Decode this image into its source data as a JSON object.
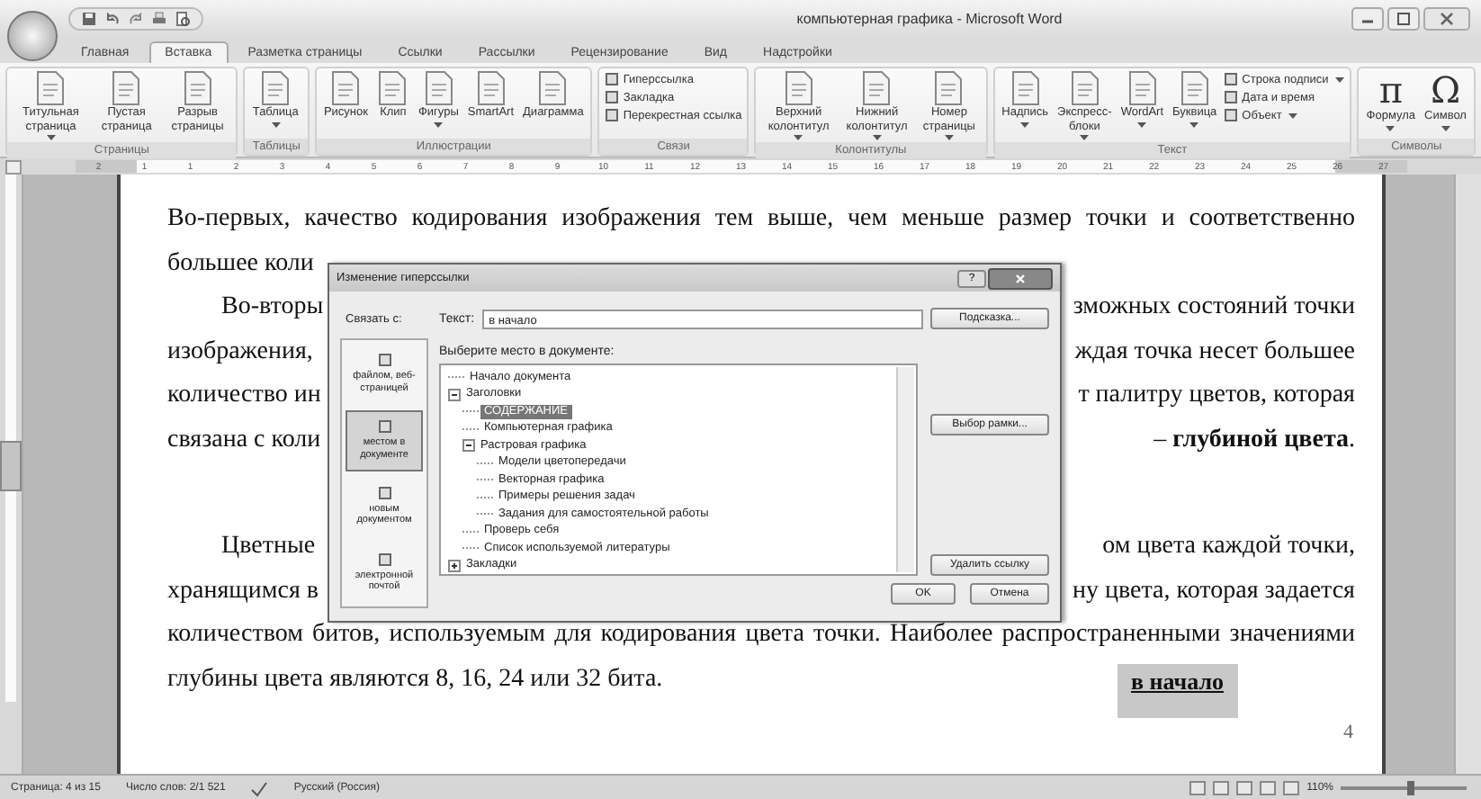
{
  "window": {
    "title": "компьютерная графика - Microsoft Word"
  },
  "tabs": [
    {
      "label": "Главная",
      "selected": false
    },
    {
      "label": "Вставка",
      "selected": true
    },
    {
      "label": "Разметка страницы",
      "selected": false
    },
    {
      "label": "Ссылки",
      "selected": false
    },
    {
      "label": "Рассылки",
      "selected": false
    },
    {
      "label": "Рецензирование",
      "selected": false
    },
    {
      "label": "Вид",
      "selected": false
    },
    {
      "label": "Надстройки",
      "selected": false
    }
  ],
  "ribbon": [
    {
      "label": "Страницы",
      "items": [
        {
          "kind": "large",
          "label": "Титульная страница",
          "menu": true
        },
        {
          "kind": "large",
          "label": "Пустая страница",
          "menu": false
        },
        {
          "kind": "large",
          "label": "Разрыв страницы",
          "menu": false
        }
      ]
    },
    {
      "label": "Таблицы",
      "items": [
        {
          "kind": "large",
          "label": "Таблица",
          "menu": true
        }
      ]
    },
    {
      "label": "Иллюстрации",
      "items": [
        {
          "kind": "large",
          "label": "Рисунок",
          "menu": false
        },
        {
          "kind": "large",
          "label": "Клип",
          "menu": false
        },
        {
          "kind": "large",
          "label": "Фигуры",
          "menu": true
        },
        {
          "kind": "large",
          "label": "SmartArt",
          "menu": false
        },
        {
          "kind": "large",
          "label": "Диаграмма",
          "menu": false
        }
      ]
    },
    {
      "label": "Связи",
      "items": [
        {
          "kind": "small",
          "label": "Гиперссылка",
          "menu": false
        },
        {
          "kind": "small",
          "label": "Закладка",
          "menu": false
        },
        {
          "kind": "small",
          "label": "Перекрестная ссылка",
          "menu": false
        }
      ]
    },
    {
      "label": "Колонтитулы",
      "items": [
        {
          "kind": "large",
          "label": "Верхний колонтитул",
          "menu": true
        },
        {
          "kind": "large",
          "label": "Нижний колонтитул",
          "menu": true
        },
        {
          "kind": "large",
          "label": "Номер страницы",
          "menu": true
        }
      ]
    },
    {
      "label": "Текст",
      "items": [
        {
          "kind": "large",
          "label": "Надпись",
          "menu": true
        },
        {
          "kind": "large",
          "label": "Экспресс-блоки",
          "menu": true
        },
        {
          "kind": "large",
          "label": "WordArt",
          "menu": true
        },
        {
          "kind": "large",
          "label": "Буквица",
          "menu": true
        },
        {
          "kind": "small",
          "label": "Строка подписи",
          "menu": true
        },
        {
          "kind": "small",
          "label": "Дата и время",
          "menu": false
        },
        {
          "kind": "small",
          "label": "Объект",
          "menu": true
        }
      ]
    },
    {
      "label": "Символы",
      "items": [
        {
          "kind": "glyph",
          "glyph": "π",
          "label": "Формула",
          "menu": true
        },
        {
          "kind": "glyph",
          "glyph": "Ω",
          "label": "Символ",
          "menu": true
        }
      ]
    }
  ],
  "ruler": {
    "labels": [
      "2",
      "1",
      "1",
      "2",
      "3",
      "4",
      "5",
      "6",
      "7",
      "8",
      "9",
      "10",
      "11",
      "12",
      "13",
      "14",
      "15",
      "16",
      "17",
      "18",
      "19",
      "20",
      "21",
      "22",
      "23",
      "24",
      "25",
      "26",
      "27"
    ]
  },
  "document": {
    "lines": [
      {
        "text": "Во-первых, качество кодирования изображения тем выше, чем меньше размер точки и соответственно",
        "justify": true
      },
      {
        "left": "большее коли"
      },
      {
        "left": "Во-вторы",
        "right": "зможных состояний точки",
        "indent": true
      },
      {
        "left": "изображения,",
        "right": "ждая точка несет большее"
      },
      {
        "left": "количество ин",
        "right": "т палитру цветов, которая"
      },
      {
        "left": "связана с коли",
        "right": "– **глубиной цвета**."
      },
      {
        "left": "Цветные",
        "right": "ом цвета каждой точки,",
        "indent": true,
        "blank_line_before": true
      },
      {
        "left": "хранящимся в",
        "right": "ну цвета, которая задается"
      },
      {
        "text": "количеством битов, используемым для кодирования цвета точки. Наиболее распространенными значениями",
        "justify": true
      },
      {
        "text": "глубины цвета являются 8, 16, 24 или 32 бита.",
        "link": "в начало"
      }
    ],
    "page_number": "4"
  },
  "dialog": {
    "title": "Изменение гиперссылки",
    "link_with_label": "Связать с:",
    "link_with": [
      {
        "label": "файлом, веб-страницей",
        "selected": false
      },
      {
        "label": "местом в документе",
        "selected": true
      },
      {
        "label": "новым документом",
        "selected": false
      },
      {
        "label": "электронной почтой",
        "selected": false
      }
    ],
    "text_label": "Текст:",
    "text_value": "в начало",
    "tooltip_button": "Подсказка...",
    "place_label": "Выберите место в документе:",
    "tree": [
      {
        "label": "Начало документа",
        "selected": false
      },
      {
        "label": "Заголовки",
        "selected": false,
        "expanded": true,
        "children": [
          {
            "label": "СОДЕРЖАНИЕ",
            "selected": true
          },
          {
            "label": "Компьютерная графика",
            "selected": false
          },
          {
            "label": "Растровая графика",
            "selected": false,
            "expanded": true,
            "children": [
              {
                "label": "Модели цветопередачи",
                "selected": false
              },
              {
                "label": "Векторная графика",
                "selected": false
              },
              {
                "label": "Примеры решения задач",
                "selected": false
              },
              {
                "label": "Задания для самостоятельной работы",
                "selected": false
              }
            ]
          },
          {
            "label": "Проверь себя",
            "selected": false
          },
          {
            "label": "Список используемой литературы",
            "selected": false
          }
        ]
      },
      {
        "label": "Закладки",
        "selected": false,
        "expanded": false
      }
    ],
    "frame_button": "Выбор рамки...",
    "remove_button": "Удалить ссылку",
    "ok_button": "OK",
    "cancel_button": "Отмена",
    "help_button": "?"
  },
  "status_bar": {
    "page": "Страница: 4 из 15",
    "words": "Число слов: 2/1 521",
    "language": "Русский (Россия)",
    "zoom": "110%",
    "zoom_slider": {
      "level": 0.55
    }
  }
}
